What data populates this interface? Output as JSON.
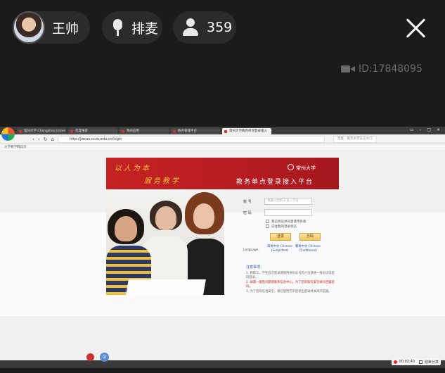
{
  "stream": {
    "host_name": "王帅",
    "mic_label": "排麦",
    "viewer_count": "359",
    "room_id": "ID:17848095"
  },
  "browser": {
    "tabs": [
      {
        "title": "常州大学 Changzhou Unive",
        "active": false
      },
      {
        "title": "百度搜索",
        "active": false
      },
      {
        "title": "我的应用",
        "active": false
      },
      {
        "title": "教务管理平台",
        "active": false
      },
      {
        "title": "常州大学教务单点登录接入",
        "active": true
      }
    ],
    "url": "http://jwcas.cczu.edu.cn/login",
    "search_placeholder": "百度：南京大学东方大门",
    "bookmark": "大学教学网首页"
  },
  "page": {
    "slogan_1": "以人为本",
    "slogan_2": "服务教学",
    "university": "常州大学",
    "system_title": "教务单点登录接入平台",
    "username_label": "帐 号",
    "username_placeholder": "请输入您的工号 / 学号",
    "password_label": "密 码",
    "check_1": "我已阅读并同意使用条款",
    "check_2": "记住我的登录状态",
    "login_button": "登录",
    "reset_button": "忘码",
    "language_label": "Language:",
    "lang_cn": "简体中文 Chinese (Simplified)",
    "lang_en": "繁体中文 Chinese (Traditional)",
    "notice_title": "注意事项：",
    "notice_1": "1. 教职工、学生首次登录请使用身份证号后六位及统一身份认证密码登录。",
    "notice_2": "2. 如遇一般性问题请联系信息中心，为了您的账号安全请勿泄露密码。",
    "notice_3": "3. 为了您的信息安全，请在使用完毕后退出登录并关闭浏览器。"
  },
  "recorder": {
    "time": "00:02:40",
    "stop_label": "结束分享"
  },
  "colors": {
    "banner_red": "#c52122",
    "slogan_gold": "#f3c23c",
    "stream_bg": "#1b1b1b"
  }
}
